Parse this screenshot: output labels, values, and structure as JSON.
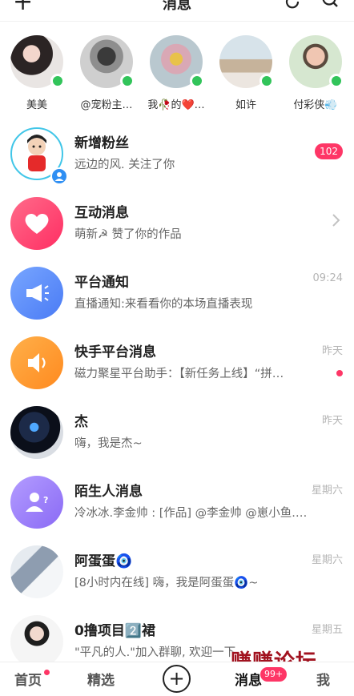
{
  "header": {
    "title": "消息",
    "add_icon": "plus-icon",
    "refresh_icon": "refresh-icon",
    "search_icon": "search-icon"
  },
  "stories": [
    {
      "name": "美美",
      "online": true
    },
    {
      "name": "@宠粉主…",
      "online": true
    },
    {
      "name": "我🥀的❤️…",
      "online": true
    },
    {
      "name": "如许",
      "online": true
    },
    {
      "name": "付彩侠💨",
      "online": true
    }
  ],
  "conversations": [
    {
      "title": "新增粉丝",
      "subtitle": "远边的风. 关注了你",
      "time": "",
      "badge": "102",
      "icon": "new-follower-avatar"
    },
    {
      "title": "互动消息",
      "subtitle": "萌新☭ 赞了你的作品",
      "time": "",
      "badge": "",
      "icon": "heart-icon"
    },
    {
      "title": "平台通知",
      "subtitle": "直播通知:来看看你的本场直播表现",
      "time": "09:24",
      "badge": "",
      "icon": "megaphone-icon"
    },
    {
      "title": "快手平台消息",
      "subtitle": "磁力聚星平台助手：【新任务上线】“拼…",
      "time": "昨天",
      "badge": "",
      "icon": "speaker-icon"
    },
    {
      "title": "杰",
      "subtitle": "嗨，我是杰~",
      "time": "昨天",
      "badge": "",
      "icon": "user-avatar"
    },
    {
      "title": "陌生人消息",
      "subtitle": "冷冰冰.李金帅 : [作品] @李金帅 @崽小鱼.…",
      "time": "星期六",
      "badge": "",
      "icon": "stranger-icon"
    },
    {
      "title": "阿蛋蛋🧿",
      "subtitle": "[8小时内在线] 嗨，我是阿蛋蛋🧿~",
      "time": "星期六",
      "badge": "",
      "icon": "user-avatar"
    },
    {
      "title": "0撸项目2️⃣裙",
      "subtitle": "\"平凡的人.\"加入群聊, 欢迎一下",
      "time": "星期五",
      "badge": "",
      "icon": "group-avatar"
    }
  ],
  "tabbar": {
    "home": "首页",
    "featured": "精选",
    "create": "+",
    "messages": "消息",
    "messages_badge": "99+",
    "me": "我"
  },
  "watermark": "赚赚论坛",
  "colors": {
    "accent": "#fe3666",
    "online": "#32c45a",
    "heart_grad": "#ff3a6d",
    "notice_blue": "#5b8cff",
    "orange": "#ff9b2f",
    "purple": "#9a7bff"
  }
}
